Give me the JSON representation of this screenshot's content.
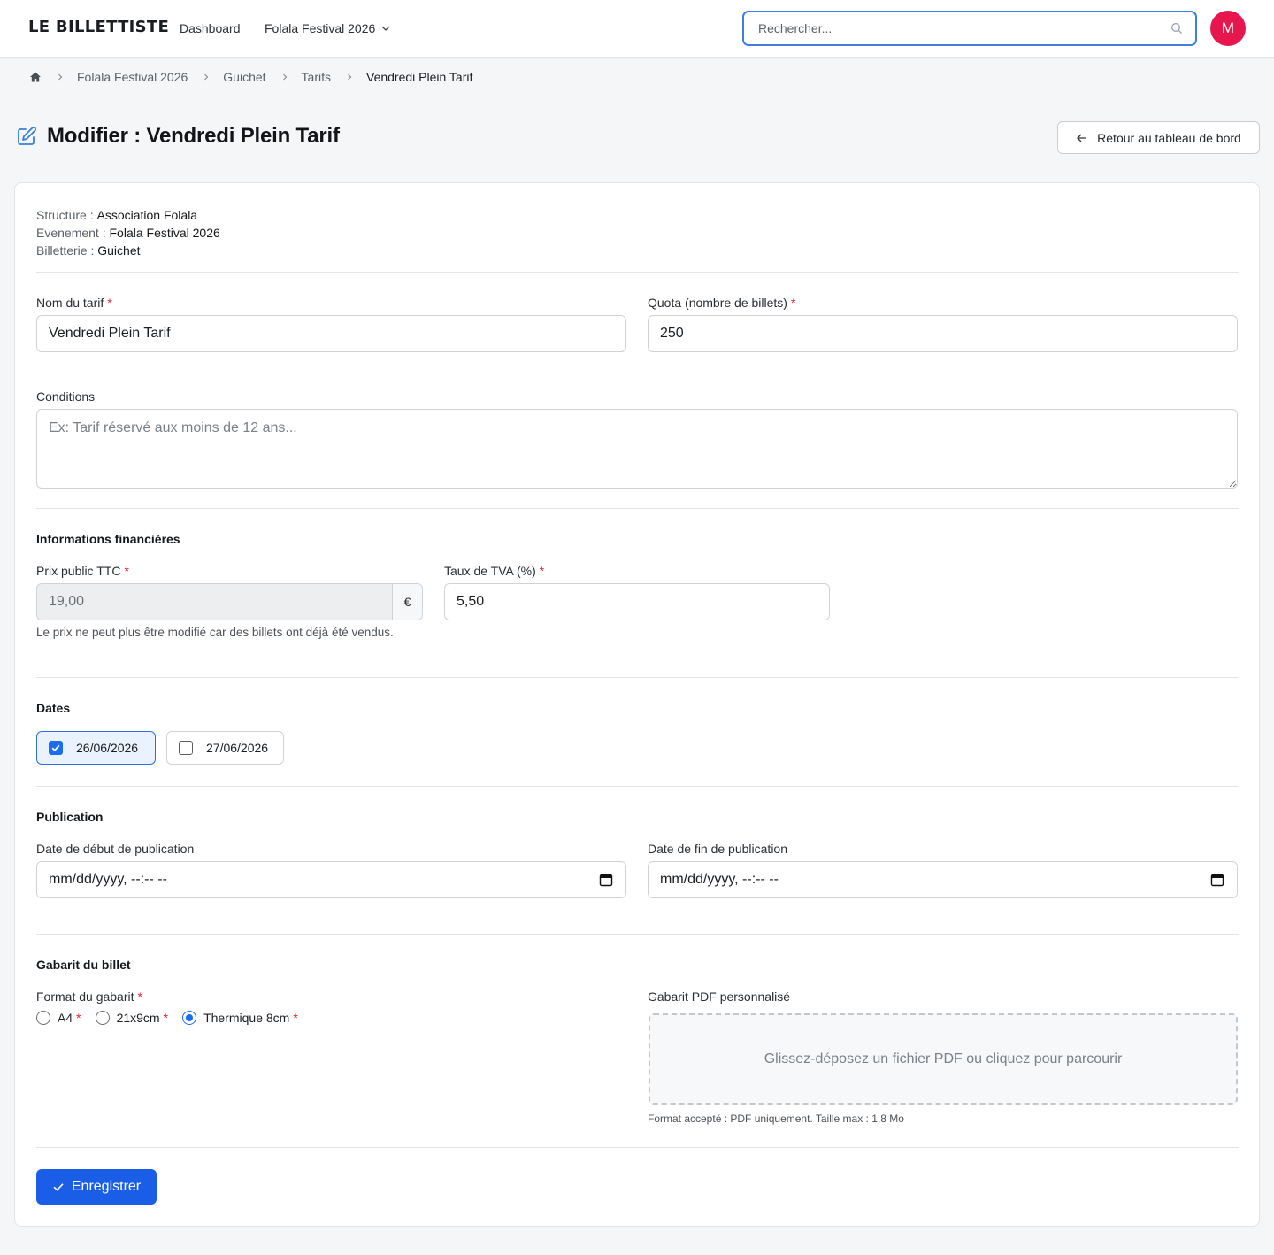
{
  "app": {
    "brand": "LE BILLETTISTE"
  },
  "nav": {
    "dashboard": "Dashboard",
    "event": "Folala Festival 2026"
  },
  "search": {
    "placeholder": "Rechercher...",
    "value": ""
  },
  "user": {
    "initial": "M",
    "avatar_color": "#e8164f"
  },
  "breadcrumb": [
    "Folala Festival 2026",
    "Guichet",
    "Tarifs",
    "Vendredi Plein Tarif"
  ],
  "page": {
    "title": "Modifier : Vendredi Plein Tarif",
    "back_label": "Retour au tableau de bord"
  },
  "meta": [
    {
      "label": "Structure :",
      "value": "Association Folala"
    },
    {
      "label": "Evenement :",
      "value": "Folala Festival 2026"
    },
    {
      "label": "Billetterie :",
      "value": "Guichet"
    }
  ],
  "form": {
    "name": {
      "label": "Nom du tarif",
      "required_mark": "*",
      "value": "Vendredi Plein Tarif"
    },
    "quota": {
      "label": "Quota (nombre de billets)",
      "required_mark": "*",
      "value": "250"
    },
    "conditions": {
      "label": "Conditions",
      "placeholder": "Ex: Tarif réservé aux moins de 12 ans...",
      "value": ""
    },
    "finance": {
      "title": "Informations financières",
      "price": {
        "label": "Prix public TTC",
        "required_mark": "*",
        "value": "19,00",
        "currency": "€",
        "disabled": true,
        "help": "Le prix ne peut plus être modifié car des billets ont déjà été vendus."
      },
      "vat": {
        "label": "Taux de TVA (%)",
        "required_mark": "*",
        "value": "5,50"
      }
    },
    "dates": {
      "title": "Dates",
      "options": [
        {
          "label": "26/06/2026",
          "checked": true
        },
        {
          "label": "27/06/2026",
          "checked": false
        }
      ]
    },
    "publication": {
      "title": "Publication",
      "start": {
        "label": "Date de début de publication",
        "value": "mm/dd/yyyy, --:-- --"
      },
      "end": {
        "label": "Date de fin de publication",
        "value": "mm/dd/yyyy, --:-- --"
      }
    },
    "template": {
      "title": "Gabarit du billet",
      "format": {
        "label": "Format du gabarit",
        "required_mark": "*",
        "options": [
          {
            "label": "A4",
            "required_mark": "*",
            "selected": false
          },
          {
            "label": "21x9cm",
            "required_mark": "*",
            "selected": false
          },
          {
            "label": "Thermique 8cm",
            "required_mark": "*",
            "selected": true
          }
        ]
      },
      "pdf": {
        "label": "Gabarit PDF personnalisé",
        "dropzone": "Glissez-déposez un fichier PDF ou cliquez pour parcourir",
        "help": "Format accepté : PDF uniquement. Taille max : 1,8 Mo"
      }
    },
    "save_label": "Enregistrer"
  },
  "colors": {
    "primary": "#1a5ee8",
    "focus": "#3f7fe0",
    "required": "#e0213b",
    "checkbox": "#1a6cf0"
  }
}
